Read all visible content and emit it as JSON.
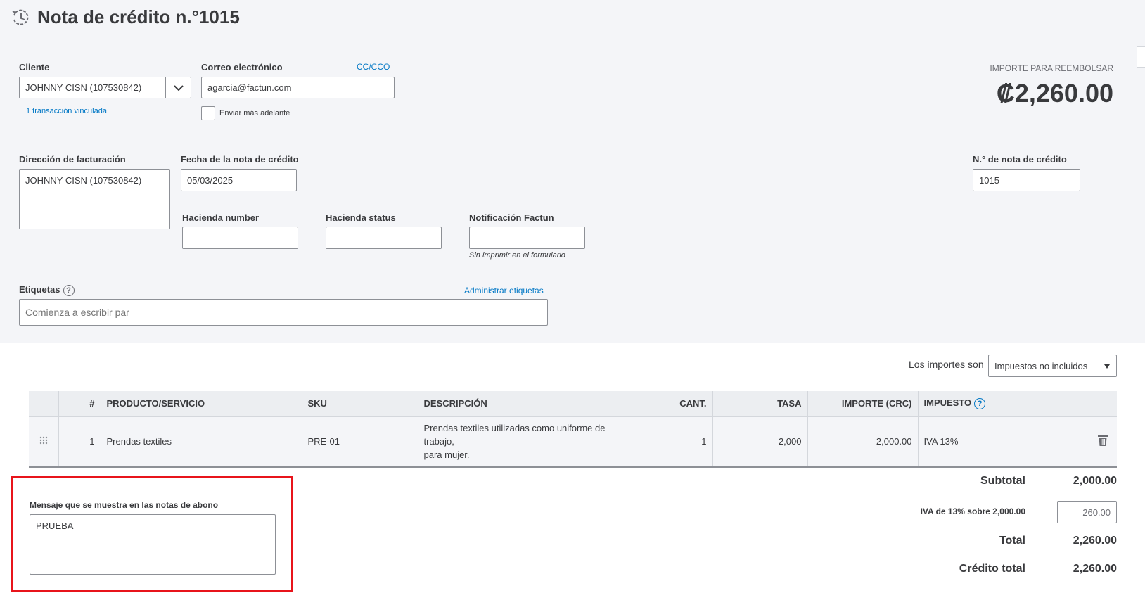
{
  "header": {
    "title": "Nota de crédito n.°1015"
  },
  "customer": {
    "label": "Cliente",
    "value": "JOHNNY CISN (107530842)",
    "linked": "1 transacción vinculada"
  },
  "email": {
    "label": "Correo electrónico",
    "cc_link": "CC/CCO",
    "value": "agarcia@factun.com",
    "send_later_label": "Enviar más adelante"
  },
  "refund": {
    "label": "IMPORTE PARA REEMBOLSAR",
    "amount": "₡2,260.00"
  },
  "billing": {
    "label": "Dirección de facturación",
    "value": "JOHNNY CISN (107530842)"
  },
  "credit_date": {
    "label": "Fecha de la nota de crédito",
    "value": "05/03/2025"
  },
  "credit_no": {
    "label": "N.° de nota de crédito",
    "value": "1015"
  },
  "hacienda_number": {
    "label": "Hacienda number",
    "value": ""
  },
  "hacienda_status": {
    "label": "Hacienda status",
    "value": ""
  },
  "notificacion": {
    "label": "Notificación Factun",
    "hint": "Sin imprimir en el formulario",
    "value": ""
  },
  "tags": {
    "label": "Etiquetas",
    "manage_link": "Administrar etiquetas",
    "placeholder": "Comienza a escribir par"
  },
  "amounts_are": {
    "label": "Los importes son",
    "value": "Impuestos no incluidos"
  },
  "table": {
    "headers": [
      "",
      "#",
      "PRODUCTO/SERVICIO",
      "SKU",
      "DESCRIPCIÓN",
      "CANT.",
      "TASA",
      "IMPORTE (CRC)",
      "IMPUESTO",
      ""
    ],
    "rows": [
      {
        "num": "1",
        "product": "Prendas textiles",
        "sku": "PRE-01",
        "desc_line1": "Prendas textiles utilizadas como uniforme de",
        "desc_line2": "trabajo,",
        "desc_line3": "para mujer.",
        "qty": "1",
        "rate": "2,000",
        "amount": "2,000.00",
        "tax": "IVA 13%"
      }
    ]
  },
  "message": {
    "label": "Mensaje que se muestra en las notas de abono",
    "value": "PRUEBA"
  },
  "totals": {
    "subtotal_label": "Subtotal",
    "subtotal_value": "2,000.00",
    "iva_label": "IVA de 13% sobre 2,000.00",
    "iva_value": "260.00",
    "total_label": "Total",
    "total_value": "2,260.00",
    "credit_total_label": "Crédito total",
    "credit_total_value": "2,260.00"
  },
  "colors": {
    "link": "#0077c5",
    "highlight": "#e8141b",
    "background": "#f4f5f8"
  }
}
